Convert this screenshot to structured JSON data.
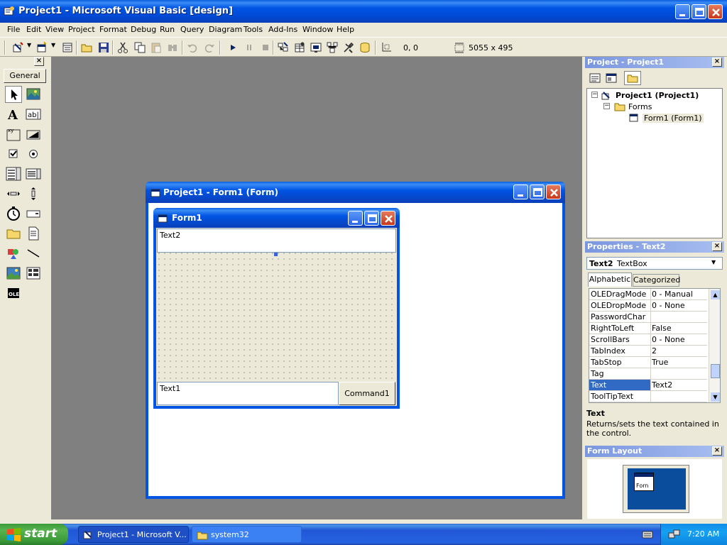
{
  "window": {
    "title": "Project1 - Microsoft Visual Basic [design]"
  },
  "menu": [
    "File",
    "Edit",
    "View",
    "Project",
    "Format",
    "Debug",
    "Run",
    "Query",
    "Diagram",
    "Tools",
    "Add-Ins",
    "Window",
    "Help"
  ],
  "toolbar": {
    "position": "0, 0",
    "size": "5055 x 495"
  },
  "toolbox": {
    "tab_label": "General",
    "tools": [
      "pointer-icon",
      "picturebox-icon",
      "label-icon",
      "textbox-icon",
      "frame-icon",
      "commandbutton-icon",
      "checkbox-icon",
      "optionbutton-icon",
      "combobox-icon",
      "listbox-icon",
      "hscrollbar-icon",
      "vscrollbar-icon",
      "timer-icon",
      "drivelistbox-icon",
      "dirlistbox-icon",
      "filelistbox-icon",
      "shape-icon",
      "line-icon",
      "image-icon",
      "data-icon",
      "ole-icon"
    ],
    "ole_text": "OLE"
  },
  "mdi_window": {
    "title": "Project1 - Form1 (Form)"
  },
  "form": {
    "title": "Form1",
    "text2": "Text2",
    "text1": "Text1",
    "command1": "Command1"
  },
  "project": {
    "header": "Project - Project1",
    "root": "Project1 (Project1)",
    "folder": "Forms",
    "item": "Form1 (Form1)"
  },
  "properties": {
    "header": "Properties - Text2",
    "object_name": "Text2",
    "object_type": "TextBox",
    "tab_alphabetic": "Alphabetic",
    "tab_categorized": "Categorized",
    "rows": [
      {
        "name": "OLEDragMode",
        "value": "0 - Manual"
      },
      {
        "name": "OLEDropMode",
        "value": "0 - None"
      },
      {
        "name": "PasswordChar",
        "value": ""
      },
      {
        "name": "RightToLeft",
        "value": "False"
      },
      {
        "name": "ScrollBars",
        "value": "0 - None"
      },
      {
        "name": "TabIndex",
        "value": "2"
      },
      {
        "name": "TabStop",
        "value": "True"
      },
      {
        "name": "Tag",
        "value": ""
      },
      {
        "name": "Text",
        "value": "Text2"
      },
      {
        "name": "ToolTipText",
        "value": ""
      }
    ],
    "selected_row": "Text",
    "desc_title": "Text",
    "desc_body": "Returns/sets the text contained in the control."
  },
  "form_layout": {
    "header": "Form Layout",
    "preview_label": "Forn"
  },
  "taskbar": {
    "start": "start",
    "tasks": [
      {
        "label": "Project1 - Microsoft V..."
      },
      {
        "label": "system32"
      }
    ],
    "clock": "7:20 AM"
  },
  "colors": {
    "xp_blue": "#0054e3",
    "selection": "#316ac5",
    "panel_header": "#7a96df",
    "start_green": "#3c9a3a"
  }
}
